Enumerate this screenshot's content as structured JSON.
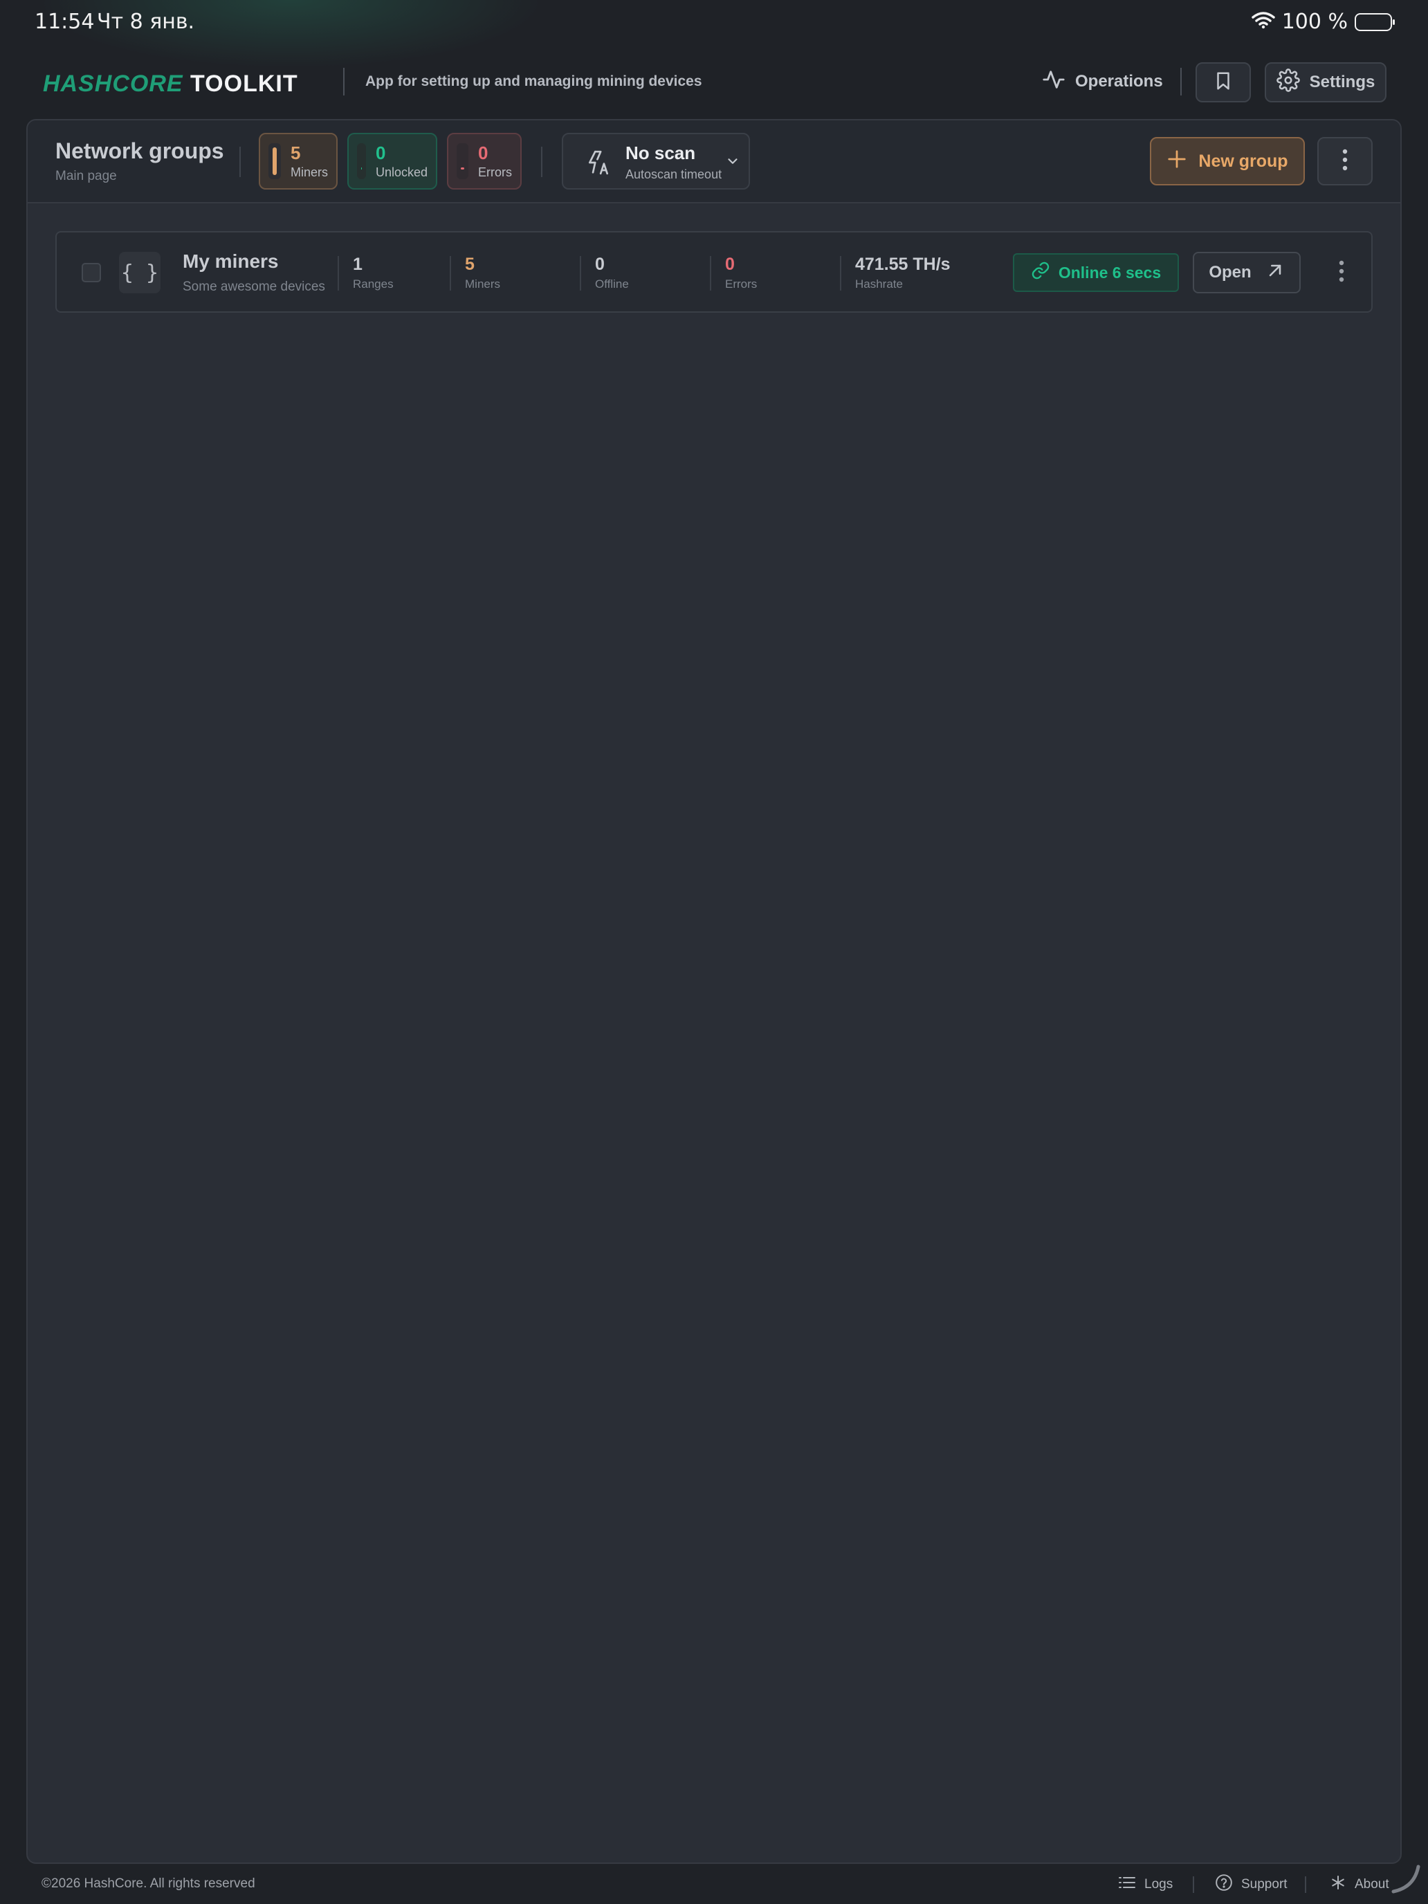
{
  "status_bar": {
    "time": "11:54",
    "date": "Чт 8 янв.",
    "battery": "100 %"
  },
  "header": {
    "logo_part1": "HASHCORE",
    "logo_part2": "TOOLKIT",
    "tagline": "App for setting up and managing mining devices",
    "operations_label": "Operations",
    "settings_label": "Settings"
  },
  "toolbar": {
    "title": "Network groups",
    "subtitle": "Main page",
    "stats": {
      "miners": {
        "value": "5",
        "label": "Miners"
      },
      "unlocked": {
        "value": "0",
        "label": "Unlocked"
      },
      "errors": {
        "value": "0",
        "label": "Errors"
      }
    },
    "scan": {
      "title": "No scan",
      "subtitle": "Autoscan timeout"
    },
    "new_group_label": "New group"
  },
  "groups": [
    {
      "name": "My miners",
      "description": "Some awesome devices",
      "ranges": {
        "value": "1",
        "label": "Ranges"
      },
      "miners": {
        "value": "5",
        "label": "Miners"
      },
      "offline": {
        "value": "0",
        "label": "Offline"
      },
      "errors": {
        "value": "0",
        "label": "Errors"
      },
      "hashrate": {
        "value": "471.55 TH/s",
        "label": "Hashrate"
      },
      "status": "Online 6 secs",
      "open_label": "Open"
    }
  ],
  "footer": {
    "copyright": "©2026 HashCore. All rights reserved",
    "logs": "Logs",
    "support": "Support",
    "about": "About"
  },
  "colors": {
    "accent_green": "#1fbf8a",
    "accent_orange": "#e0a46c",
    "error_red": "#e66b74",
    "background": "#1f2227",
    "panel": "#2a2e36"
  },
  "icons": [
    "wifi-icon",
    "battery-icon",
    "activity-icon",
    "bookmark-icon",
    "gear-icon",
    "auto-flash-icon",
    "chevron-down-icon",
    "plus-icon",
    "more-vertical-icon",
    "braces-icon",
    "link-icon",
    "arrow-up-right-icon",
    "list-icon",
    "help-circle-icon",
    "asterisk-icon"
  ]
}
